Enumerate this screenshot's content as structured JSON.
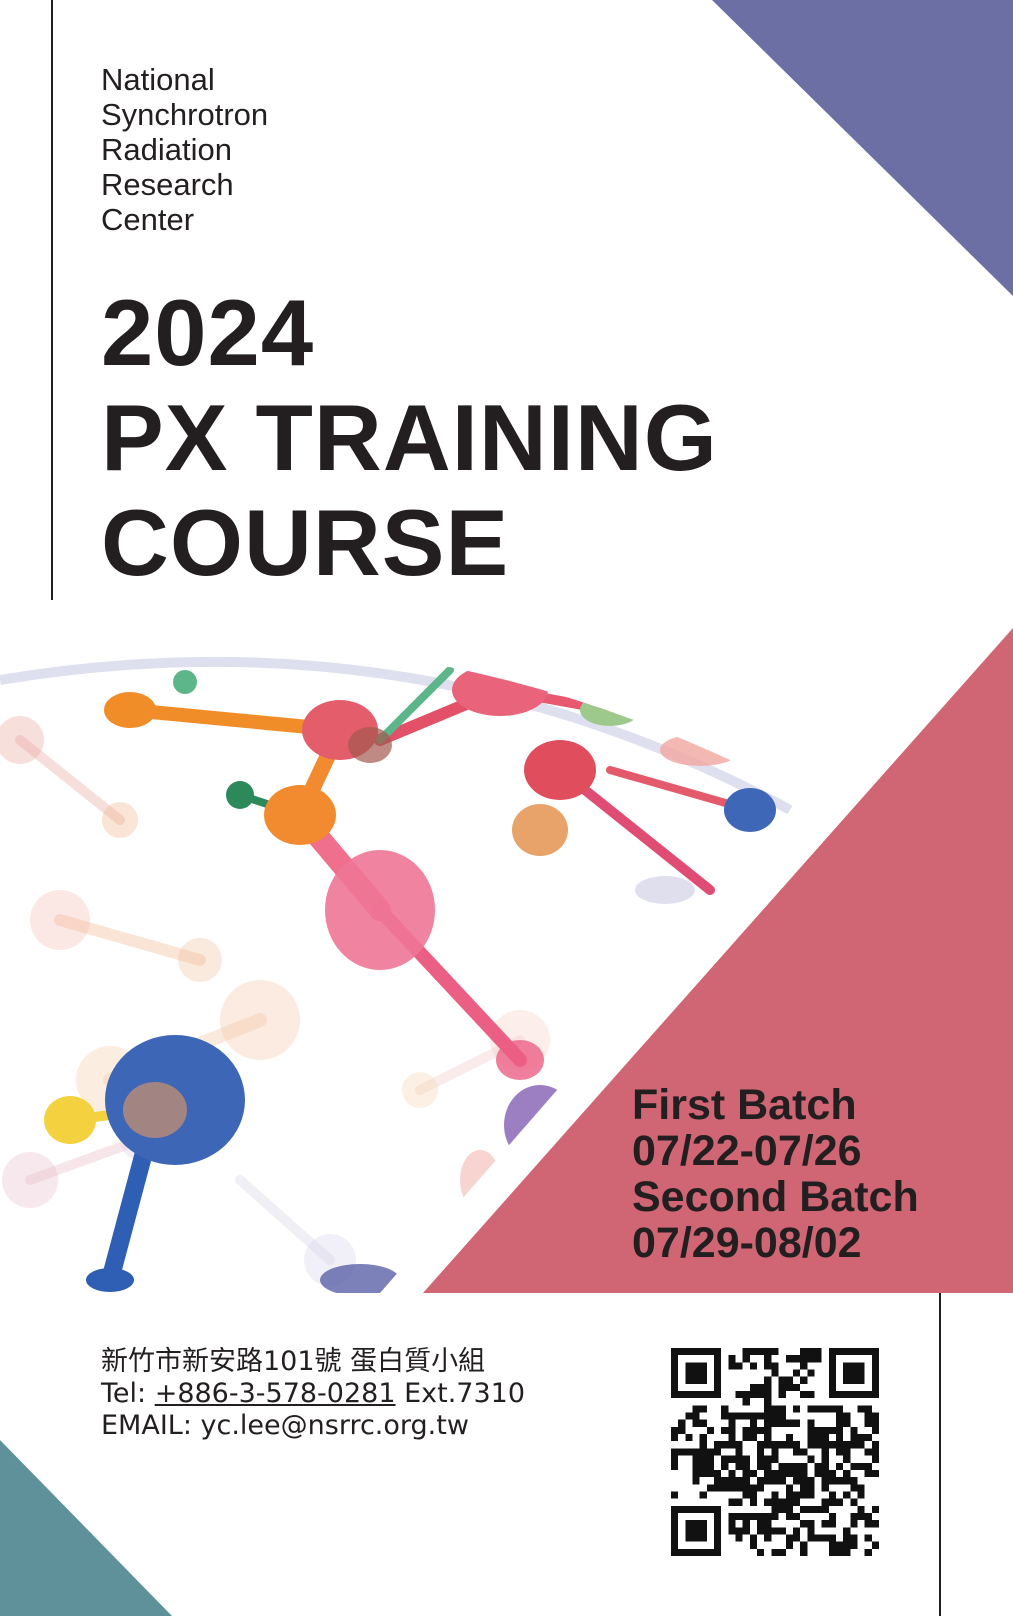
{
  "organization": {
    "lines": [
      "National",
      "Synchrotron",
      "Radiation",
      "Research",
      "Center"
    ]
  },
  "title": {
    "year": "2024",
    "line2": "PX TRAINING",
    "line3": "COURSE"
  },
  "batches": {
    "first_label": "First Batch",
    "first_dates": "07/22-07/26",
    "second_label": "Second Batch",
    "second_dates": "07/29-08/02"
  },
  "contact": {
    "address": "新竹市新安路101號 蛋白質小組",
    "tel_prefix": "Tel: ",
    "tel_number": "+886-3-578-0281",
    "tel_ext": " Ext.7310",
    "email": "EMAIL: yc.lee@nsrrc.org.tw"
  },
  "colors": {
    "top_right_triangle": "#6b6fa4",
    "bottom_right_triangle": "#d06574",
    "bottom_left_triangle": "#5e9199",
    "text": "#231f20"
  },
  "icons": {
    "qr": "qr-code-icon",
    "artwork": "molecule-network-illustration"
  }
}
